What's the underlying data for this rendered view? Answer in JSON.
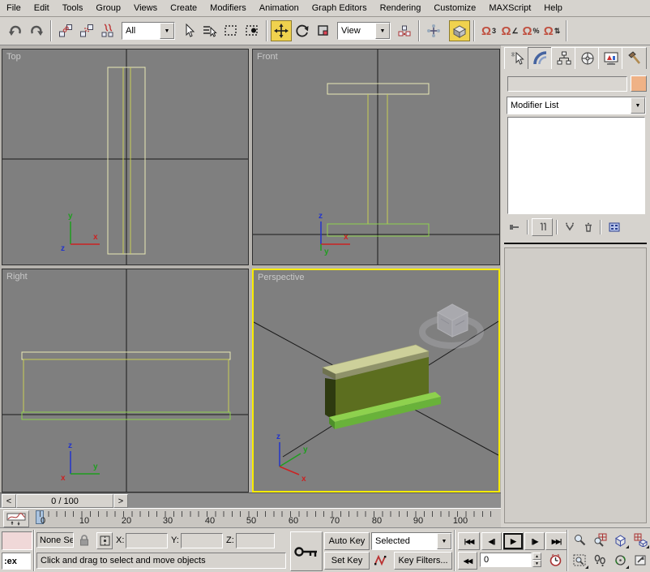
{
  "menu": {
    "items": [
      "File",
      "Edit",
      "Tools",
      "Group",
      "Views",
      "Create",
      "Modifiers",
      "Animation",
      "Graph Editors",
      "Rendering",
      "Customize",
      "MAXScript",
      "Help"
    ]
  },
  "toolbar": {
    "selection_filter_value": "All",
    "coordinate_system_value": "View"
  },
  "icons": {
    "dropdown_arrow": "▼",
    "spinner_up": "▲",
    "spinner_down": "▼",
    "magnet": "Ω",
    "snap_3": "3",
    "snap_angle": "∠",
    "snap_percent": "%",
    "snap_spinner": "⇅",
    "time_slider_prev": "<",
    "time_slider_next": ">",
    "go_to_start": "|◀◀",
    "previous_frame": "◀||",
    "play": "▶",
    "next_frame": "||▶",
    "go_to_end": "▶▶|",
    "key_mode": "◀◀"
  },
  "viewports": {
    "top": {
      "label": "Top",
      "axis_up": "y",
      "axis_right": "x",
      "axis_third": "z"
    },
    "front": {
      "label": "Front",
      "axis_up": "z",
      "axis_right": "x",
      "axis_third": "y"
    },
    "right": {
      "label": "Right",
      "axis_up": "z",
      "axis_right": "y",
      "axis_third": "x"
    },
    "perspective": {
      "label": "Perspective",
      "axis_up": "z",
      "axis_right": "y",
      "axis_third": "x"
    }
  },
  "time_slider": {
    "value": "0 / 100"
  },
  "track_bar": {
    "labels": [
      "0",
      "10",
      "20",
      "30",
      "40",
      "50",
      "60",
      "70",
      "80",
      "90",
      "100"
    ]
  },
  "command_panel": {
    "object_name_value": "",
    "modifier_list_value": "Modifier List"
  },
  "status_bar": {
    "listener_text": ":ex",
    "selection_status": "None Se",
    "x_label": "X:",
    "y_label": "Y:",
    "z_label": "Z:",
    "x_value": "",
    "y_value": "",
    "z_value": "",
    "prompt": "Click and drag to select and move objects",
    "auto_key_label": "Auto Key",
    "set_key_label": "Set Key",
    "key_filter_value": "Selected",
    "key_filters_label": "Key Filters...",
    "frame_value": "0"
  },
  "colors": {
    "active_viewport_border": "#f8ec00",
    "viewport_background": "#7f7f7f",
    "tool_active_background": "#f0d24e",
    "object_color_swatch": "#efb286",
    "wireframe_pale": "#e9e9b5",
    "wireframe_yellowgreen": "#c9cf56",
    "wireframe_green": "#8fd14e",
    "beam_top": "#cdd09a",
    "beam_web": "#5c6e1f",
    "beam_bottom": "#7dc242"
  }
}
